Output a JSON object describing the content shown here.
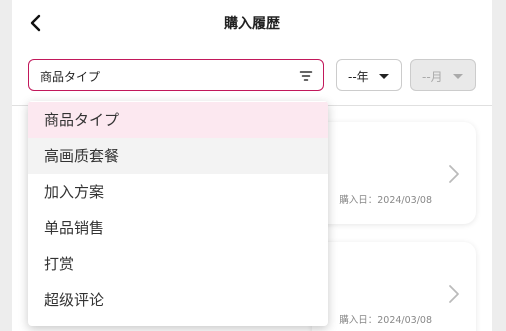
{
  "header": {
    "title": "購入履歴",
    "back_icon": "chevron-left-icon"
  },
  "filters": {
    "type": {
      "value": "商品タイプ",
      "icon": "filter-icon",
      "border_color": "#c2185b"
    },
    "year": {
      "value": "--年",
      "icon": "caret-down-icon"
    },
    "month": {
      "value": "--月",
      "icon": "caret-down-icon",
      "disabled": true
    }
  },
  "dropdown": {
    "options": [
      {
        "label": "商品タイプ",
        "state": "selected"
      },
      {
        "label": "高画质套餐",
        "state": "hovered"
      },
      {
        "label": "加入方案",
        "state": ""
      },
      {
        "label": "单品销售",
        "state": ""
      },
      {
        "label": "打赏",
        "state": ""
      },
      {
        "label": "超级评论",
        "state": ""
      }
    ],
    "selected_color": "#fce8f0"
  },
  "purchases": [
    {
      "date": "購入日：2024/03/08"
    },
    {
      "date": "購入日：2024/03/08"
    }
  ]
}
